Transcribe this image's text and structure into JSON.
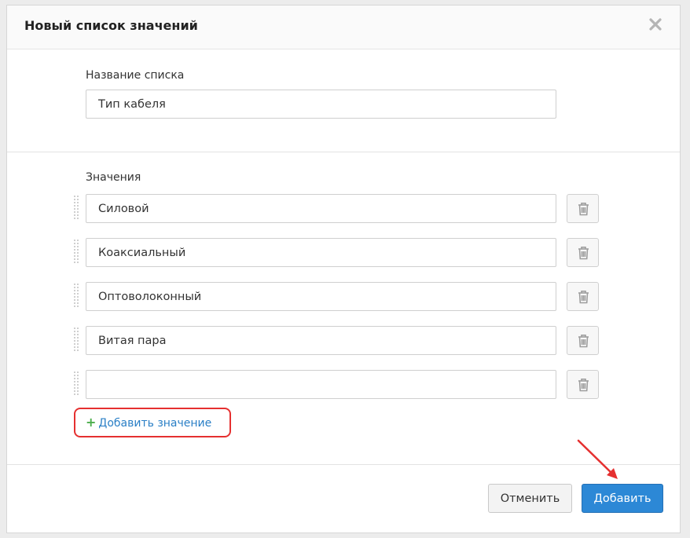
{
  "dialog": {
    "title": "Новый список значений",
    "close_icon": "close-icon"
  },
  "list_name": {
    "label": "Название списка",
    "value": "Тип кабеля"
  },
  "values": {
    "label": "Значения",
    "items": [
      {
        "value": "Силовой"
      },
      {
        "value": "Коаксиальный"
      },
      {
        "value": "Оптоволоконный"
      },
      {
        "value": "Витая пара"
      },
      {
        "value": ""
      }
    ],
    "add_icon": "plus-icon",
    "add_label": "Добавить значение",
    "delete_icon": "trash-icon",
    "drag_icon": "drag-handle-icon"
  },
  "footer": {
    "cancel_label": "Отменить",
    "submit_label": "Добавить"
  },
  "colors": {
    "primary": "#2c88d6",
    "link": "#2a7fc6",
    "add_plus": "#4cae4c",
    "annotation": "#e53030"
  }
}
